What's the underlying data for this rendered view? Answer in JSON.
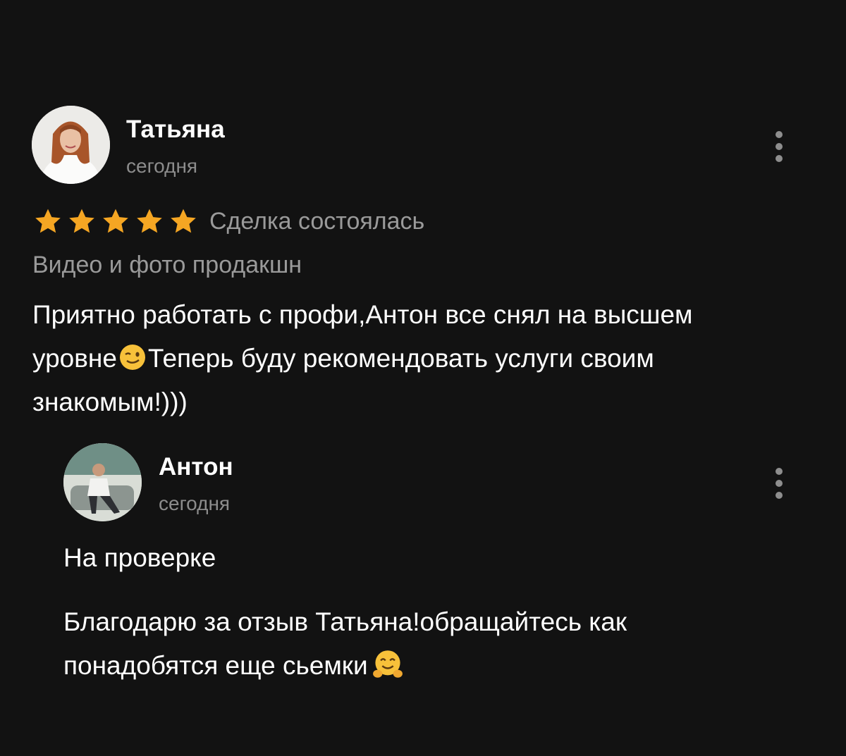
{
  "review": {
    "author_name": "Татьяна",
    "date": "сегодня",
    "rating": 5,
    "rating_max": 5,
    "deal_status": "Сделка состоялась",
    "category": "Видео и фото продакшн",
    "text_line1": "Приятно работать с профи,Антон все снял на высшем",
    "text_line2_a": "уровне",
    "text_line2_emoji": "winking-face",
    "text_line2_b": "Теперь буду рекомендовать услуги своим",
    "text_line3": "знакомым!)))"
  },
  "reply": {
    "author_name": "Антон",
    "date": "сегодня",
    "status": "На проверке",
    "text_line1": "Благодарю за отзыв Татьяна!обращайтесь как",
    "text_line2": "понадобятся еще сьемки",
    "text_emoji": "hugging-face"
  },
  "colors": {
    "background": "#121212",
    "star": "#f5a623",
    "muted_text": "#9a9a9a",
    "primary_text": "#ffffff"
  },
  "icons": {
    "menu": "kebab-menu-icon",
    "rating": "star-icon"
  }
}
